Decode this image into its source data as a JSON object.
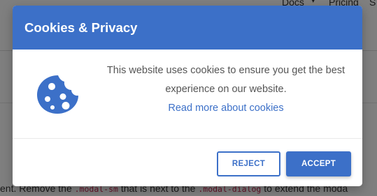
{
  "background_page": {
    "nav": {
      "docs_label": "Docs",
      "docs_caret": "▾",
      "pricing_label": "Pricing",
      "truncated_label": "S"
    },
    "text": {
      "part1": "ent. Remove the ",
      "code1": ".modal-sm",
      "part2": " that is next to the ",
      "code2": ".modal-dialog",
      "part3": " to extend the moda"
    }
  },
  "modal": {
    "title": "Cookies & Privacy",
    "message": "This website uses cookies to ensure you get the best experience on our website.",
    "read_more_link": "Read more about cookies",
    "icon": "cookie-icon",
    "buttons": {
      "reject": "REJECT",
      "accept": "ACCEPT"
    }
  },
  "colors": {
    "primary": "#3c70c8",
    "white": "#ffffff",
    "body_text": "#555555"
  }
}
